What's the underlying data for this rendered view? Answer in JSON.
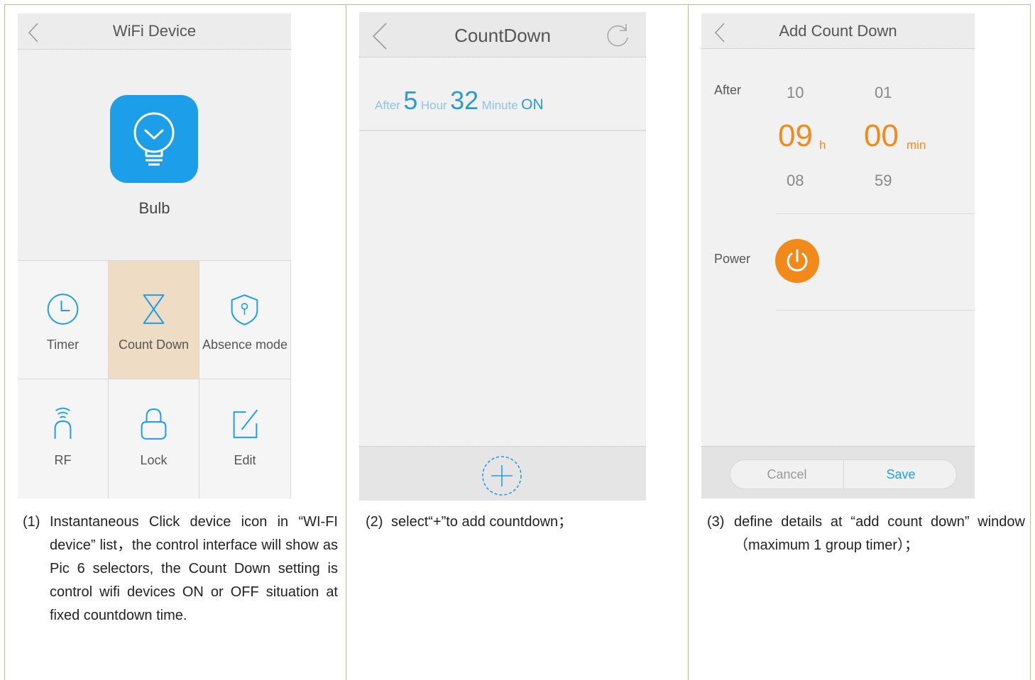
{
  "phone1": {
    "title": "WiFi Device",
    "device_label": "Bulb",
    "grid": {
      "timer": "Timer",
      "countdown": "Count Down",
      "absence": "Absence mode",
      "rf": "RF",
      "lock": "Lock",
      "edit": "Edit"
    },
    "selected_color": "#eedcc4",
    "accent": "#1c9ee8"
  },
  "phone2": {
    "title": "CountDown",
    "row": {
      "after": "After",
      "hours": "5",
      "hour_label": "Hour",
      "minutes": "32",
      "minute_label": "Minute",
      "state": "ON"
    }
  },
  "phone3": {
    "title": "Add Count Down",
    "after_label": "After",
    "hours_prev": "10",
    "hours_sel": "09",
    "hours_unit": "h",
    "hours_next": "08",
    "mins_prev": "01",
    "mins_sel": "00",
    "mins_unit": "min",
    "mins_next": "59",
    "power_label": "Power",
    "cancel": "Cancel",
    "save": "Save",
    "accent": "#f08a1a"
  },
  "captions": {
    "c1_num": "(1)",
    "c1_text": "Instantaneous Click device icon in “WI-FI device” list，the control interface will show as Pic 6 selectors, the Count Down setting is control wifi devices ON or OFF situation at fixed countdown time.",
    "c2_num": "(2)",
    "c2_text": "select“+”to add countdown；",
    "c3_num": "(3)",
    "c3_text": "define details at “add count down” window（maximum 1 group timer）；"
  }
}
